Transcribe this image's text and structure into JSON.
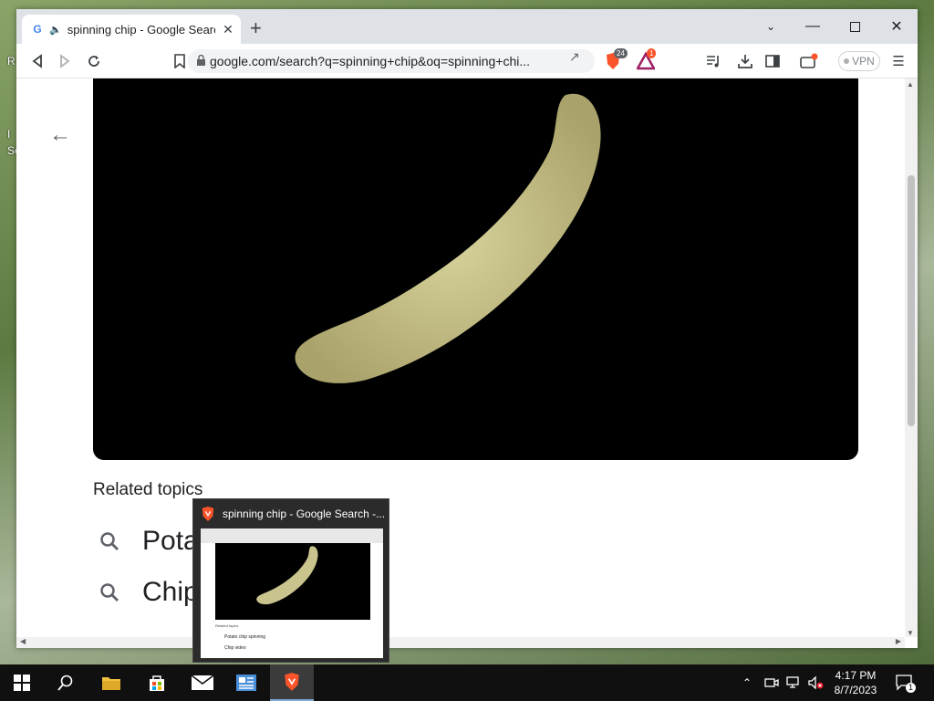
{
  "browser": {
    "tab_title": "spinning chip - Google Search",
    "url": "google.com/search?q=spinning+chip&oq=spinning+chi...",
    "shield_count": "24",
    "rewards_count": "1",
    "vpn_label": "VPN"
  },
  "content": {
    "related_title": "Related topics",
    "related_items": [
      "Potato",
      "Chip"
    ]
  },
  "preview": {
    "title": "spinning chip - Google Search -...",
    "related_title": "Related topics",
    "related_items": [
      "Potato chip spinning",
      "Chip video"
    ]
  },
  "taskbar": {
    "time": "4:17 PM",
    "date": "8/7/2023",
    "notification_count": "1"
  },
  "colors": {
    "brave_orange": "#fb542b",
    "taskbar_bg": "#101010",
    "chip": "#c9c48e"
  }
}
